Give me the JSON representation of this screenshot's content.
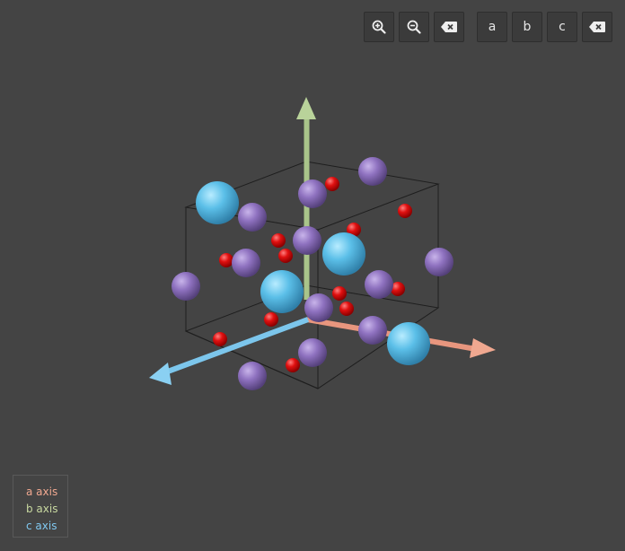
{
  "toolbar": {
    "zoom_in_icon": "zoom-in-icon",
    "zoom_out_icon": "zoom-out-icon",
    "reset_icon": "backspace-icon",
    "axis_a_label": "a",
    "axis_b_label": "b",
    "axis_c_label": "c",
    "clear_icon": "backspace-icon"
  },
  "legend": {
    "a": {
      "label": "a axis",
      "color": "#f0a890"
    },
    "b": {
      "label": "b axis",
      "color": "#c8d8a0"
    },
    "c": {
      "label": "c axis",
      "color": "#80c8f0"
    }
  },
  "colors": {
    "background": "#444444",
    "a_axis": "#e8967e",
    "b_axis": "#a9c48a",
    "c_axis": "#7cc6ec",
    "large_atom": "#5bbfe8",
    "medium_atom": "#9477c4",
    "small_atom": "#e01010",
    "cell_edges": "#1e1e1e"
  },
  "atom_kinds": [
    "large",
    "medium",
    "small"
  ]
}
